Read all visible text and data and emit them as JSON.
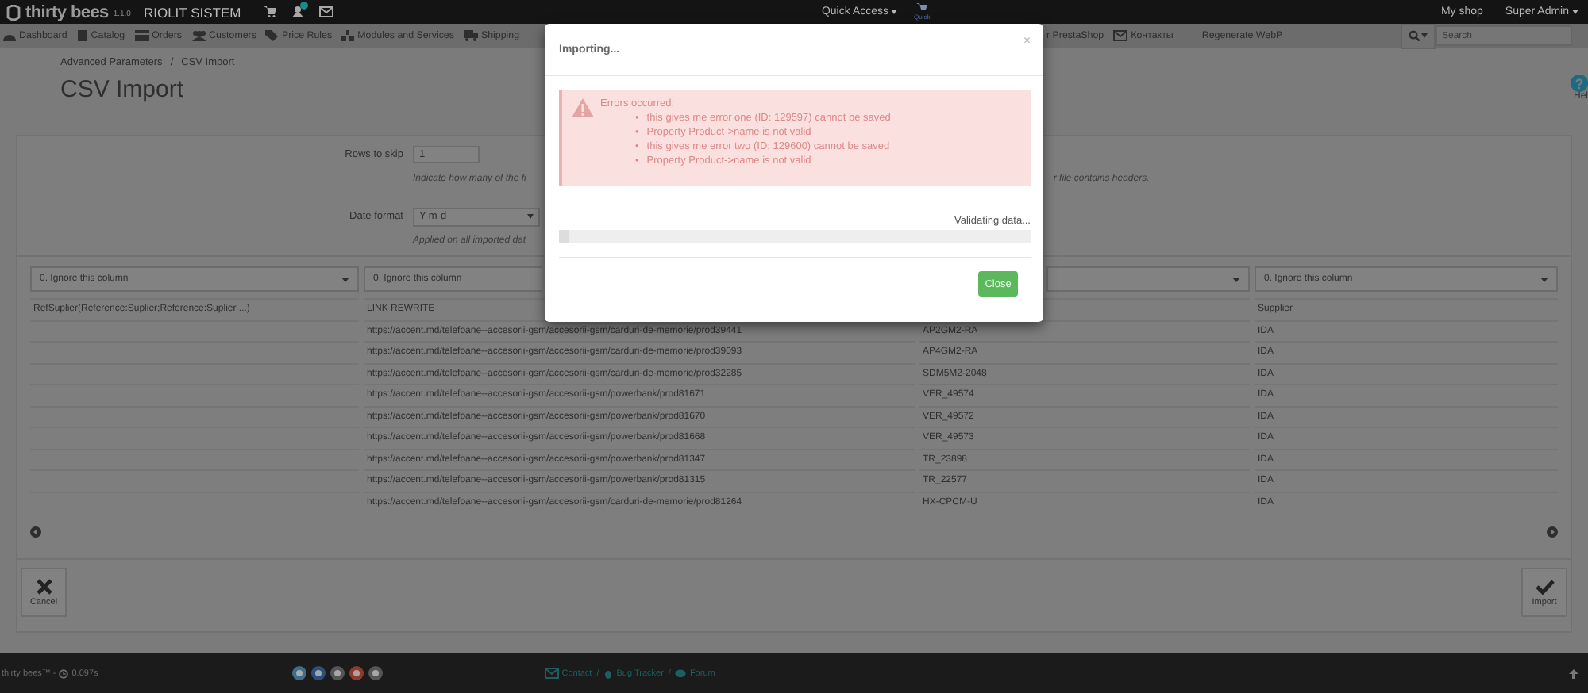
{
  "header": {
    "brand": "thirty bees",
    "version": "1.1.0",
    "shop_name": "RIOLIT SISTEM",
    "quick_access": "Quick Access",
    "quick_label": "Quick",
    "my_shop": "My shop",
    "user": "Super Admin"
  },
  "nav": {
    "items": [
      {
        "label": "Dashboard",
        "kind": "gauge"
      },
      {
        "label": "Catalog",
        "kind": "book"
      },
      {
        "label": "Orders",
        "kind": "card"
      },
      {
        "label": "Customers",
        "kind": "users"
      },
      {
        "label": "Price Rules",
        "kind": "tag"
      },
      {
        "label": "Modules and Services",
        "kind": "puzzle"
      },
      {
        "label": "Shipping",
        "kind": "truck"
      }
    ],
    "items_right": [
      {
        "label": "r PrestaShop",
        "kind": "none"
      },
      {
        "label": "Контакты",
        "kind": "envelope"
      },
      {
        "label": "Regenerate WebP",
        "kind": "none"
      }
    ],
    "search": {
      "placeholder": "Search"
    }
  },
  "breadcrumb": [
    "Advanced Parameters",
    "CSV Import"
  ],
  "breadcrumb_separator": "/",
  "page_title": "CSV Import",
  "help": {
    "icon": "?",
    "label": "Hel"
  },
  "form": {
    "rows_to_skip": {
      "label": "Rows to skip",
      "value": "1",
      "hint": "Indicate how many of the fi",
      "hint_end": "r file contains headers."
    },
    "date_format": {
      "label": "Date format",
      "value": "Y-m-d",
      "hint": "Applied on all imported dat"
    }
  },
  "table": {
    "selects": [
      "0. Ignore this column",
      "0. Ignore this column",
      "0. Ignore this column"
    ],
    "headers": [
      "RefSuplier(Reference:Suplier;Reference:Suplier ...)",
      "LINK REWRITE",
      "Supplier"
    ],
    "rows": [
      {
        "link_rewrite": "https://accent.md/telefoane--accesorii-gsm/accesorii-gsm/carduri-de-memorie/prod39441",
        "column_3": "AP2GM2-RA",
        "supplier": "IDA"
      },
      {
        "link_rewrite": "https://accent.md/telefoane--accesorii-gsm/accesorii-gsm/carduri-de-memorie/prod39093",
        "column_3": "AP4GM2-RA",
        "supplier": "IDA"
      },
      {
        "link_rewrite": "https://accent.md/telefoane--accesorii-gsm/accesorii-gsm/carduri-de-memorie/prod32285",
        "column_3": "SDM5M2-2048",
        "supplier": "IDA"
      },
      {
        "link_rewrite": "https://accent.md/telefoane--accesorii-gsm/accesorii-gsm/powerbank/prod81671",
        "column_3": "VER_49574",
        "supplier": "IDA"
      },
      {
        "link_rewrite": "https://accent.md/telefoane--accesorii-gsm/accesorii-gsm/powerbank/prod81670",
        "column_3": "VER_49572",
        "supplier": "IDA"
      },
      {
        "link_rewrite": "https://accent.md/telefoane--accesorii-gsm/accesorii-gsm/powerbank/prod81668",
        "column_3": "VER_49573",
        "supplier": "IDA"
      },
      {
        "link_rewrite": "https://accent.md/telefoane--accesorii-gsm/accesorii-gsm/powerbank/prod81347",
        "column_3": "TR_23898",
        "supplier": "IDA"
      },
      {
        "link_rewrite": "https://accent.md/telefoane--accesorii-gsm/accesorii-gsm/powerbank/prod81315",
        "column_3": "TR_22577",
        "supplier": "IDA"
      },
      {
        "link_rewrite": "https://accent.md/telefoane--accesorii-gsm/accesorii-gsm/carduri-de-memorie/prod81264",
        "column_3": "HX-CPCM-U",
        "supplier": "IDA"
      }
    ]
  },
  "actions": {
    "cancel": "Cancel",
    "import": "Import"
  },
  "footer": {
    "brand": "thirty bees™ -",
    "time": "0.097s",
    "links": [
      "Contact",
      "Bug Tracker",
      "Forum"
    ],
    "separator": "/"
  },
  "modal": {
    "title": "Importing...",
    "close_icon": "×",
    "error_title": "Errors occurred:",
    "errors": [
      "this gives me error one (ID: 129597) cannot be saved",
      "Property Product->name is not valid",
      "this gives me error two (ID: 129600) cannot be saved",
      "Property Product->name is not valid"
    ],
    "bullet": "•",
    "status": "Validating data...",
    "level": 0.02,
    "button": "Close"
  }
}
